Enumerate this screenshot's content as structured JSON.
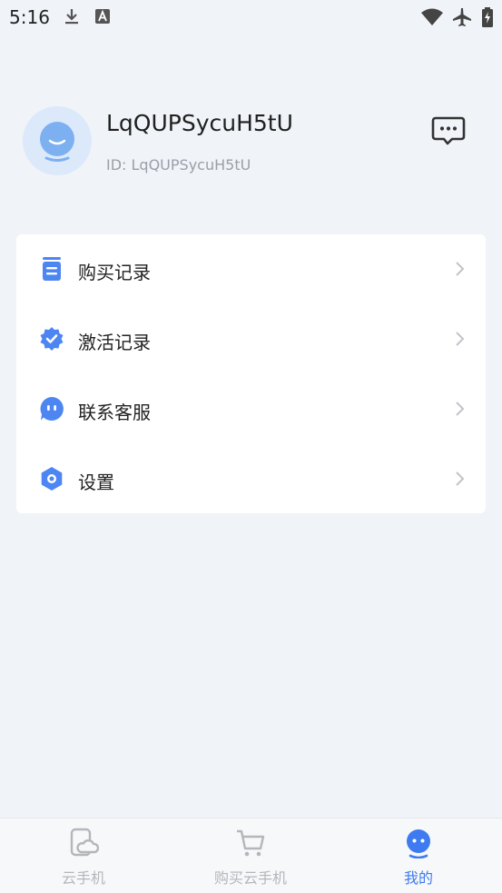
{
  "status_bar": {
    "time": "5:16",
    "icons": [
      "download-icon",
      "text-a-icon",
      "wifi-icon",
      "airplane-icon",
      "battery-charging-icon"
    ]
  },
  "profile": {
    "username": "LqQUPSycuH5tU",
    "id_text": "ID: LqQUPSycuH5tU",
    "avatar_icon": "avatar-face-icon",
    "message_icon": "chat-bubble-icon"
  },
  "menu": {
    "items": [
      {
        "label": "购买记录",
        "icon": "receipt-icon"
      },
      {
        "label": "激活记录",
        "icon": "verified-badge-icon"
      },
      {
        "label": "联系客服",
        "icon": "customer-service-icon"
      },
      {
        "label": "设置",
        "icon": "gear-icon"
      }
    ]
  },
  "bottom_nav": {
    "tabs": [
      {
        "label": "云手机",
        "icon": "cloud-phone-icon",
        "active": false
      },
      {
        "label": "购买云手机",
        "icon": "cart-icon",
        "active": false
      },
      {
        "label": "我的",
        "icon": "profile-icon",
        "active": true
      }
    ]
  },
  "colors": {
    "accent": "#3f7bf0",
    "background": "#f0f3f8",
    "inactive": "#b3b6bb"
  }
}
